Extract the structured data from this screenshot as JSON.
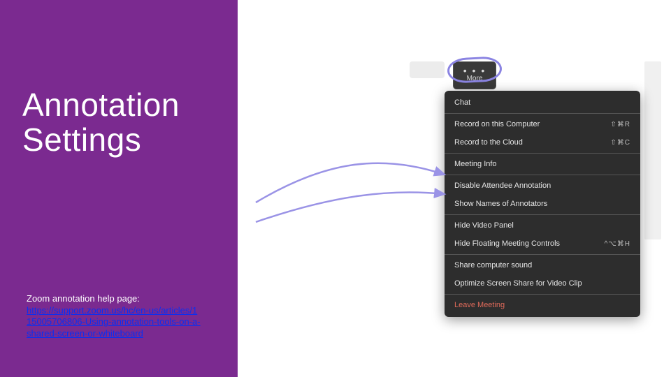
{
  "left": {
    "title_line1": "Annotation",
    "title_line2": "Settings",
    "help_intro": "Zoom annotation help page:",
    "help_link_text": "https://support.zoom.us/hc/en-us/articles/115005706806-Using-annotation-tools-on-a-shared-screen-or-whiteboard"
  },
  "more": {
    "dots": "• • •",
    "label": "More"
  },
  "menu": {
    "items": [
      {
        "label": "Chat",
        "shortcut": ""
      },
      {
        "sep": true
      },
      {
        "label": "Record on this Computer",
        "shortcut": "⇧⌘R"
      },
      {
        "label": "Record to the Cloud",
        "shortcut": "⇧⌘C"
      },
      {
        "sep": true
      },
      {
        "label": "Meeting Info",
        "shortcut": ""
      },
      {
        "sep": true
      },
      {
        "label": "Disable Attendee Annotation",
        "shortcut": ""
      },
      {
        "label": "Show Names of Annotators",
        "shortcut": ""
      },
      {
        "sep": true
      },
      {
        "label": "Hide Video Panel",
        "shortcut": ""
      },
      {
        "label": "Hide Floating Meeting Controls",
        "shortcut": "^⌥⌘H"
      },
      {
        "sep": true
      },
      {
        "label": "Share computer sound",
        "shortcut": ""
      },
      {
        "label": "Optimize Screen Share for Video Clip",
        "shortcut": ""
      },
      {
        "sep": true
      },
      {
        "label": "Leave Meeting",
        "shortcut": "",
        "leave": true
      }
    ]
  }
}
